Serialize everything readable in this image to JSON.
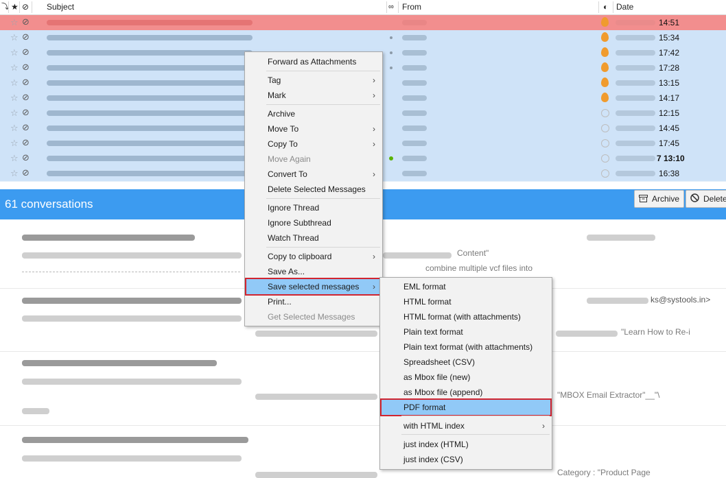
{
  "header": {
    "subject_label": "Subject",
    "from_label": "From",
    "date_label": "Date"
  },
  "rows": [
    {
      "time": "14:51",
      "selected_style": "red",
      "indicator": "flame"
    },
    {
      "time": "15:34",
      "indicator": "flame"
    },
    {
      "time": "17:42",
      "indicator": "flame"
    },
    {
      "time": "17:28",
      "indicator": "flame"
    },
    {
      "time": "13:15",
      "indicator": "flame"
    },
    {
      "time": "14:17",
      "indicator": "flame"
    },
    {
      "time": "12:15",
      "indicator": "clock"
    },
    {
      "time": "14:45",
      "indicator": "clock"
    },
    {
      "time": "17:45",
      "indicator": "clock"
    },
    {
      "time": "7 13:10",
      "indicator": "clock",
      "bold": true
    },
    {
      "time": "16:38",
      "indicator": "clock"
    }
  ],
  "conversations": {
    "count_label": "61 conversations",
    "archive_label": "Archive",
    "delete_label": "Delete"
  },
  "preview": {
    "line2_frag": "Content\"",
    "line3_frag": "combine multiple vcf files into",
    "line5_frag": "ks@systools.in>",
    "line6_frag": "\"Learn How to Re-i",
    "line7_frag": "\"MBOX Email Extractor\"__\"\\",
    "line8_frag": "Category : \"Product Page"
  },
  "context_menu": {
    "items": [
      {
        "label": "Forward as Attachments"
      },
      {
        "label": "Tag",
        "submenu": true
      },
      {
        "label": "Mark",
        "submenu": true
      },
      {
        "label": "Archive"
      },
      {
        "label": "Move To",
        "submenu": true
      },
      {
        "label": "Copy To",
        "submenu": true
      },
      {
        "label": "Move Again",
        "disabled": true
      },
      {
        "label": "Convert To",
        "submenu": true
      },
      {
        "label": "Delete Selected Messages"
      },
      {
        "label": "Ignore Thread"
      },
      {
        "label": "Ignore Subthread"
      },
      {
        "label": "Watch Thread"
      },
      {
        "label": "Copy to clipboard",
        "submenu": true
      },
      {
        "label": "Save As..."
      },
      {
        "label": "Save selected messages",
        "submenu": true,
        "highlighted": true
      },
      {
        "label": "Print..."
      },
      {
        "label": "Get Selected Messages",
        "disabled": true
      }
    ]
  },
  "save_submenu": {
    "items": [
      {
        "label": "EML format"
      },
      {
        "label": "HTML format"
      },
      {
        "label": "HTML format (with attachments)"
      },
      {
        "label": "Plain text format"
      },
      {
        "label": "Plain text format (with attachments)"
      },
      {
        "label": "Spreadsheet (CSV)"
      },
      {
        "label": "as Mbox file (new)"
      },
      {
        "label": "as Mbox file (append)"
      },
      {
        "label": "PDF format",
        "highlighted": true
      },
      {
        "label": "with HTML index",
        "submenu": true
      },
      {
        "label": "just index (HTML)"
      },
      {
        "label": "just index (CSV)"
      }
    ]
  },
  "colors": {
    "selection_row": "#cfe3f8",
    "first_row": "#f28e8e",
    "conversation_bar": "#3c9bf0",
    "menu_highlight": "#91c9f7",
    "callout_border": "#d1242f"
  },
  "icons": [
    "thread-icon",
    "star-icon",
    "attachment-icon",
    "read-status-icon",
    "priority-flame-icon",
    "clock-icon",
    "archive-icon",
    "delete-icon",
    "submenu-arrow-icon"
  ]
}
